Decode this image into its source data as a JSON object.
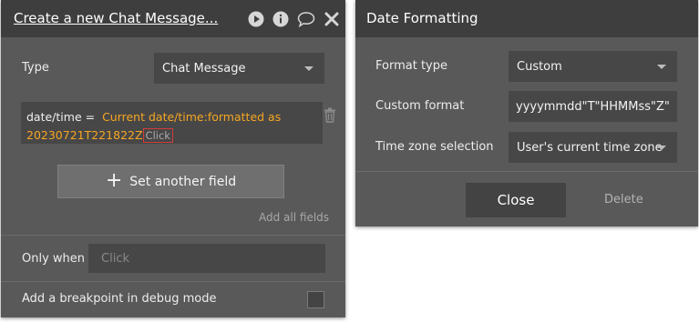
{
  "left_panel": {
    "title": "Create a new Chat Message...",
    "type_label": "Type",
    "type_value": "Chat Message",
    "field": {
      "name": "date/time",
      "operator": "=",
      "expr_part1": "Current date/time:formatted as",
      "expr_part2": "20230721T221822Z",
      "click_hint": "Click"
    },
    "set_another_field": "Set another field",
    "add_all_fields": "Add all fields",
    "only_when_label": "Only when",
    "only_when_placeholder": "Click",
    "breakpoint_label": "Add a breakpoint in debug mode",
    "breakpoint_checked": false
  },
  "right_panel": {
    "title": "Date Formatting",
    "format_type_label": "Format type",
    "format_type_value": "Custom",
    "custom_format_label": "Custom format",
    "custom_format_value": "yyyymmdd\"T\"HHMMss\"Z\"",
    "time_zone_label": "Time zone selection",
    "time_zone_value": "User's current time zone",
    "close_label": "Close",
    "delete_label": "Delete"
  },
  "icons": [
    "play-icon",
    "info-icon",
    "comment-icon",
    "close-icon",
    "trash-icon",
    "plus-icon"
  ],
  "colors": {
    "panel_bg": "#595959",
    "header_bg": "#3e3e3e",
    "input_bg": "#474747",
    "accent_orange": "#f5a623",
    "click_border": "#d03b3b"
  }
}
